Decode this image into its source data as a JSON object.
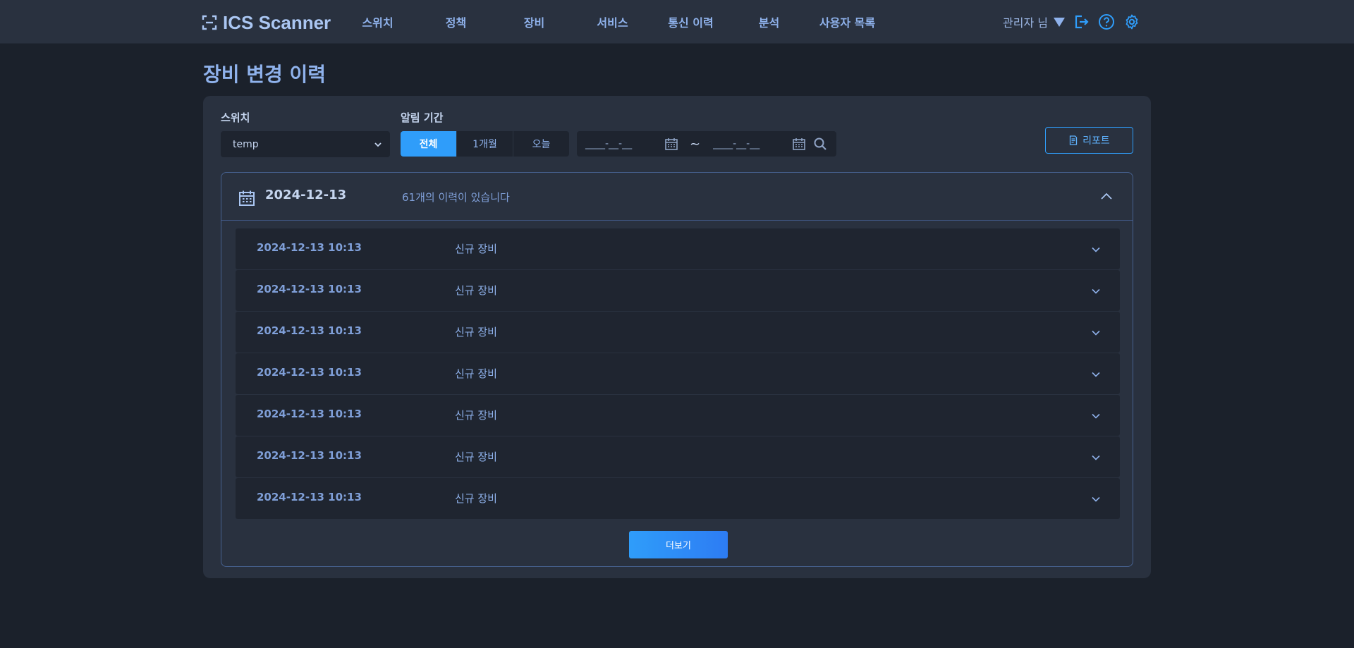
{
  "header": {
    "logo_text": "ICS Scanner",
    "nav": [
      "스위치",
      "정책",
      "장비",
      "서비스",
      "통신 이력",
      "분석",
      "사용자 목록"
    ],
    "user_label": "관리자 님"
  },
  "page": {
    "title": "장비 변경 이력"
  },
  "filters": {
    "switch_label": "스위치",
    "switch_value": "temp",
    "period_label": "알림 기간",
    "period_options": [
      "전체",
      "1개월",
      "오늘"
    ],
    "period_selected": "전체",
    "date_from": "____-__-__",
    "date_to": "____-__-__",
    "tilde": "~",
    "report_label": "리포트"
  },
  "group": {
    "date": "2024-12-13",
    "count_text": "61개의 이력이 있습니다",
    "rows": [
      {
        "time": "2024-12-13 10:13",
        "type": "신규 장비"
      },
      {
        "time": "2024-12-13 10:13",
        "type": "신규 장비"
      },
      {
        "time": "2024-12-13 10:13",
        "type": "신규 장비"
      },
      {
        "time": "2024-12-13 10:13",
        "type": "신규 장비"
      },
      {
        "time": "2024-12-13 10:13",
        "type": "신규 장비"
      },
      {
        "time": "2024-12-13 10:13",
        "type": "신규 장비"
      },
      {
        "time": "2024-12-13 10:13",
        "type": "신규 장비"
      }
    ],
    "more_label": "더보기"
  },
  "colors": {
    "accent": "#2f9dfa",
    "text": "#8fb2ec",
    "background": "#1b212b",
    "panel": "#29313f"
  }
}
